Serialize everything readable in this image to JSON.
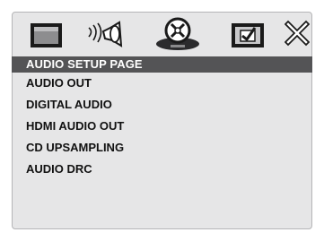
{
  "tabs": [
    {
      "id": "tv-display",
      "icon": "tv-display-icon"
    },
    {
      "id": "audio",
      "icon": "audio-speaker-icon"
    },
    {
      "id": "disc",
      "icon": "disc-icon",
      "selected": true
    },
    {
      "id": "preferences",
      "icon": "checkbox-tv-icon"
    },
    {
      "id": "exit",
      "icon": "close-icon"
    }
  ],
  "menu": {
    "header": "AUDIO SETUP PAGE",
    "items": [
      "AUDIO OUT",
      "DIGITAL AUDIO",
      "HDMI AUDIO OUT",
      "CD UPSAMPLING",
      "AUDIO DRC"
    ]
  },
  "colors": {
    "screen_bg": "#e6e6e7",
    "header_bg": "#545456",
    "header_text": "#ffffff",
    "item_text": "#111111"
  }
}
